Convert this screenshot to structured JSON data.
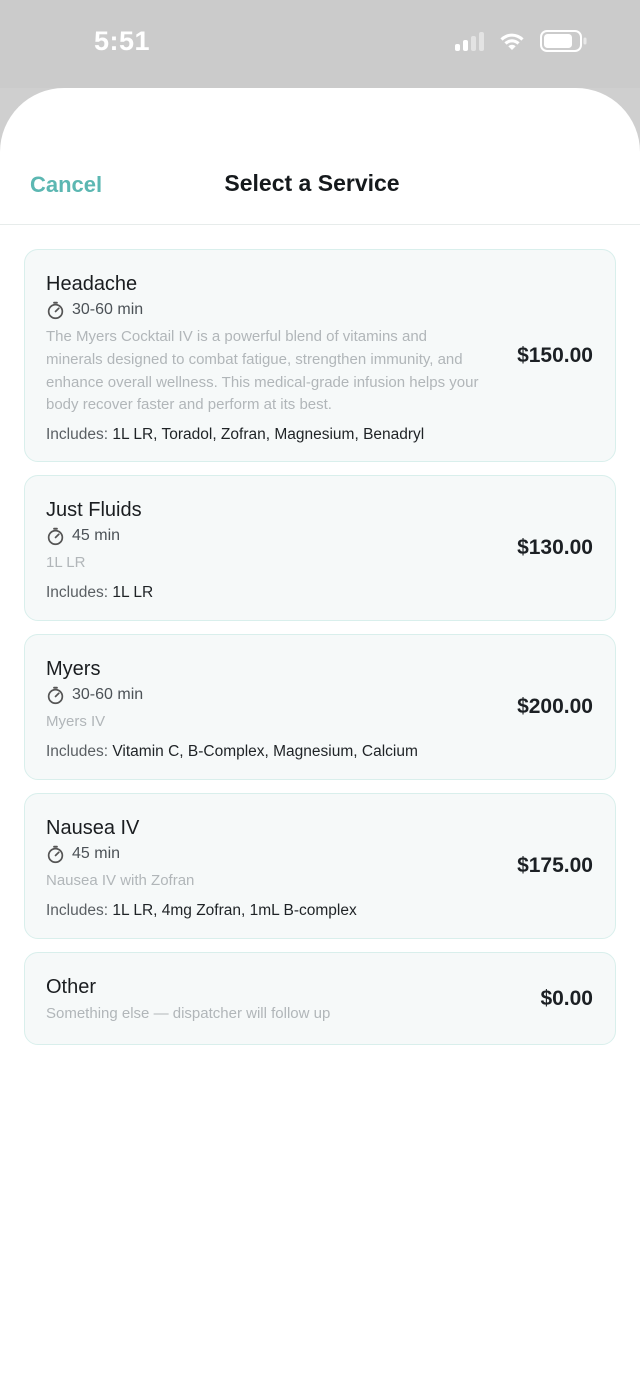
{
  "status": {
    "time": "5:51"
  },
  "nav": {
    "cancel": "Cancel",
    "title": "Select a Service"
  },
  "services": [
    {
      "name": "Headache",
      "duration": "30-60 min",
      "description": "The Myers Cocktail IV is a powerful blend of vitamins and minerals designed to combat fatigue, strengthen immunity, and enhance overall wellness. This medical-grade infusion helps your body recover faster and perform at its best.",
      "includes_label": "Includes:",
      "includes": "1L LR, Toradol, Zofran, Magnesium, Benadryl",
      "price": "$150.00"
    },
    {
      "name": "Just Fluids",
      "duration": "45 min",
      "description": "1L LR",
      "includes_label": "Includes:",
      "includes": "1L LR",
      "price": "$130.00"
    },
    {
      "name": "Myers",
      "duration": "30-60 min",
      "description": "Myers IV",
      "includes_label": "Includes:",
      "includes": "Vitamin C, B-Complex, Magnesium, Calcium",
      "price": "$200.00"
    },
    {
      "name": "Nausea IV",
      "duration": "45 min",
      "description": "Nausea IV with Zofran",
      "includes_label": "Includes:",
      "includes": "1L LR, 4mg Zofran, 1mL B-complex",
      "price": "$175.00"
    },
    {
      "name": "Other",
      "description": "Something else — dispatcher will follow up",
      "price": "$0.00"
    }
  ],
  "icons": {
    "duration": "stopwatch-icon"
  },
  "colors": {
    "accent": "#5cb7b2",
    "card_border": "#d9efec",
    "card_bg": "#f6f9f9"
  }
}
